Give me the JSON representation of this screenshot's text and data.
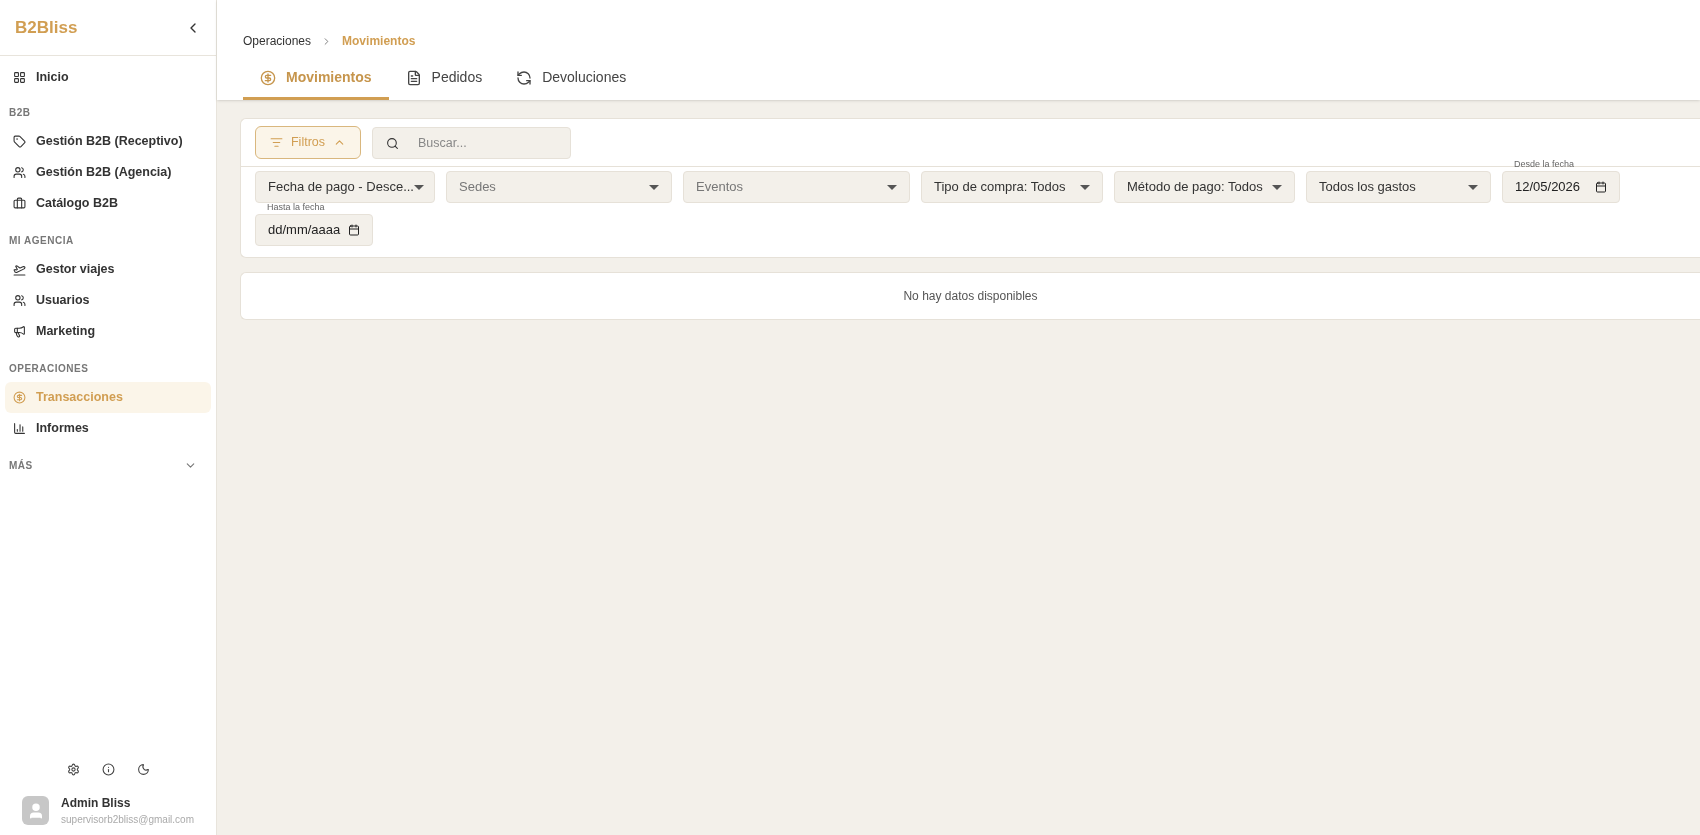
{
  "sidebar": {
    "logo": "B2Bliss",
    "sections": [
      {
        "items": [
          {
            "label": "Inicio",
            "selected": false
          }
        ]
      },
      {
        "title": "B2B",
        "items": [
          {
            "label": "Gestión B2B (Receptivo)",
            "selected": false
          },
          {
            "label": "Gestión B2B (Agencia)",
            "selected": false
          },
          {
            "label": "Catálogo B2B",
            "selected": false
          }
        ]
      },
      {
        "title": "MI AGENCIA",
        "items": [
          {
            "label": "Gestor viajes",
            "selected": false
          },
          {
            "label": "Usuarios",
            "selected": false
          },
          {
            "label": "Marketing",
            "selected": false
          }
        ]
      },
      {
        "title": "OPERACIONES",
        "items": [
          {
            "label": "Transacciones",
            "selected": true
          },
          {
            "label": "Informes",
            "selected": false
          }
        ]
      },
      {
        "title": "MÁS",
        "expanded": false
      }
    ],
    "user": {
      "name": "Admin Bliss",
      "email": "supervisorb2bliss@gmail.com"
    }
  },
  "breadcrumb": [
    "Operaciones",
    "Movimientos"
  ],
  "tabs": [
    {
      "label": "Movimientos",
      "selected": true
    },
    {
      "label": "Pedidos",
      "selected": false
    },
    {
      "label": "Devoluciones",
      "selected": false
    }
  ],
  "filters_button": {
    "label": "Filtros",
    "expanded": true
  },
  "search": {
    "placeholder": "Buscar..."
  },
  "filters": [
    {
      "kind": "select",
      "value": "Fecha de pago - Desce..."
    },
    {
      "kind": "select",
      "placeholder": "Sedes"
    },
    {
      "kind": "select",
      "placeholder": "Eventos"
    },
    {
      "kind": "select",
      "value": "Tipo de compra: Todos"
    },
    {
      "kind": "select",
      "value": "Método de pago: Todos"
    },
    {
      "kind": "select",
      "value": "Todos los gastos"
    },
    {
      "kind": "date",
      "label": "Desde la fecha",
      "value": "12/05/2026"
    },
    {
      "kind": "date",
      "label": "Hasta la fecha",
      "placeholder": "dd/mm/aaaa"
    }
  ],
  "empty_message": "No hay datos disponibles"
}
